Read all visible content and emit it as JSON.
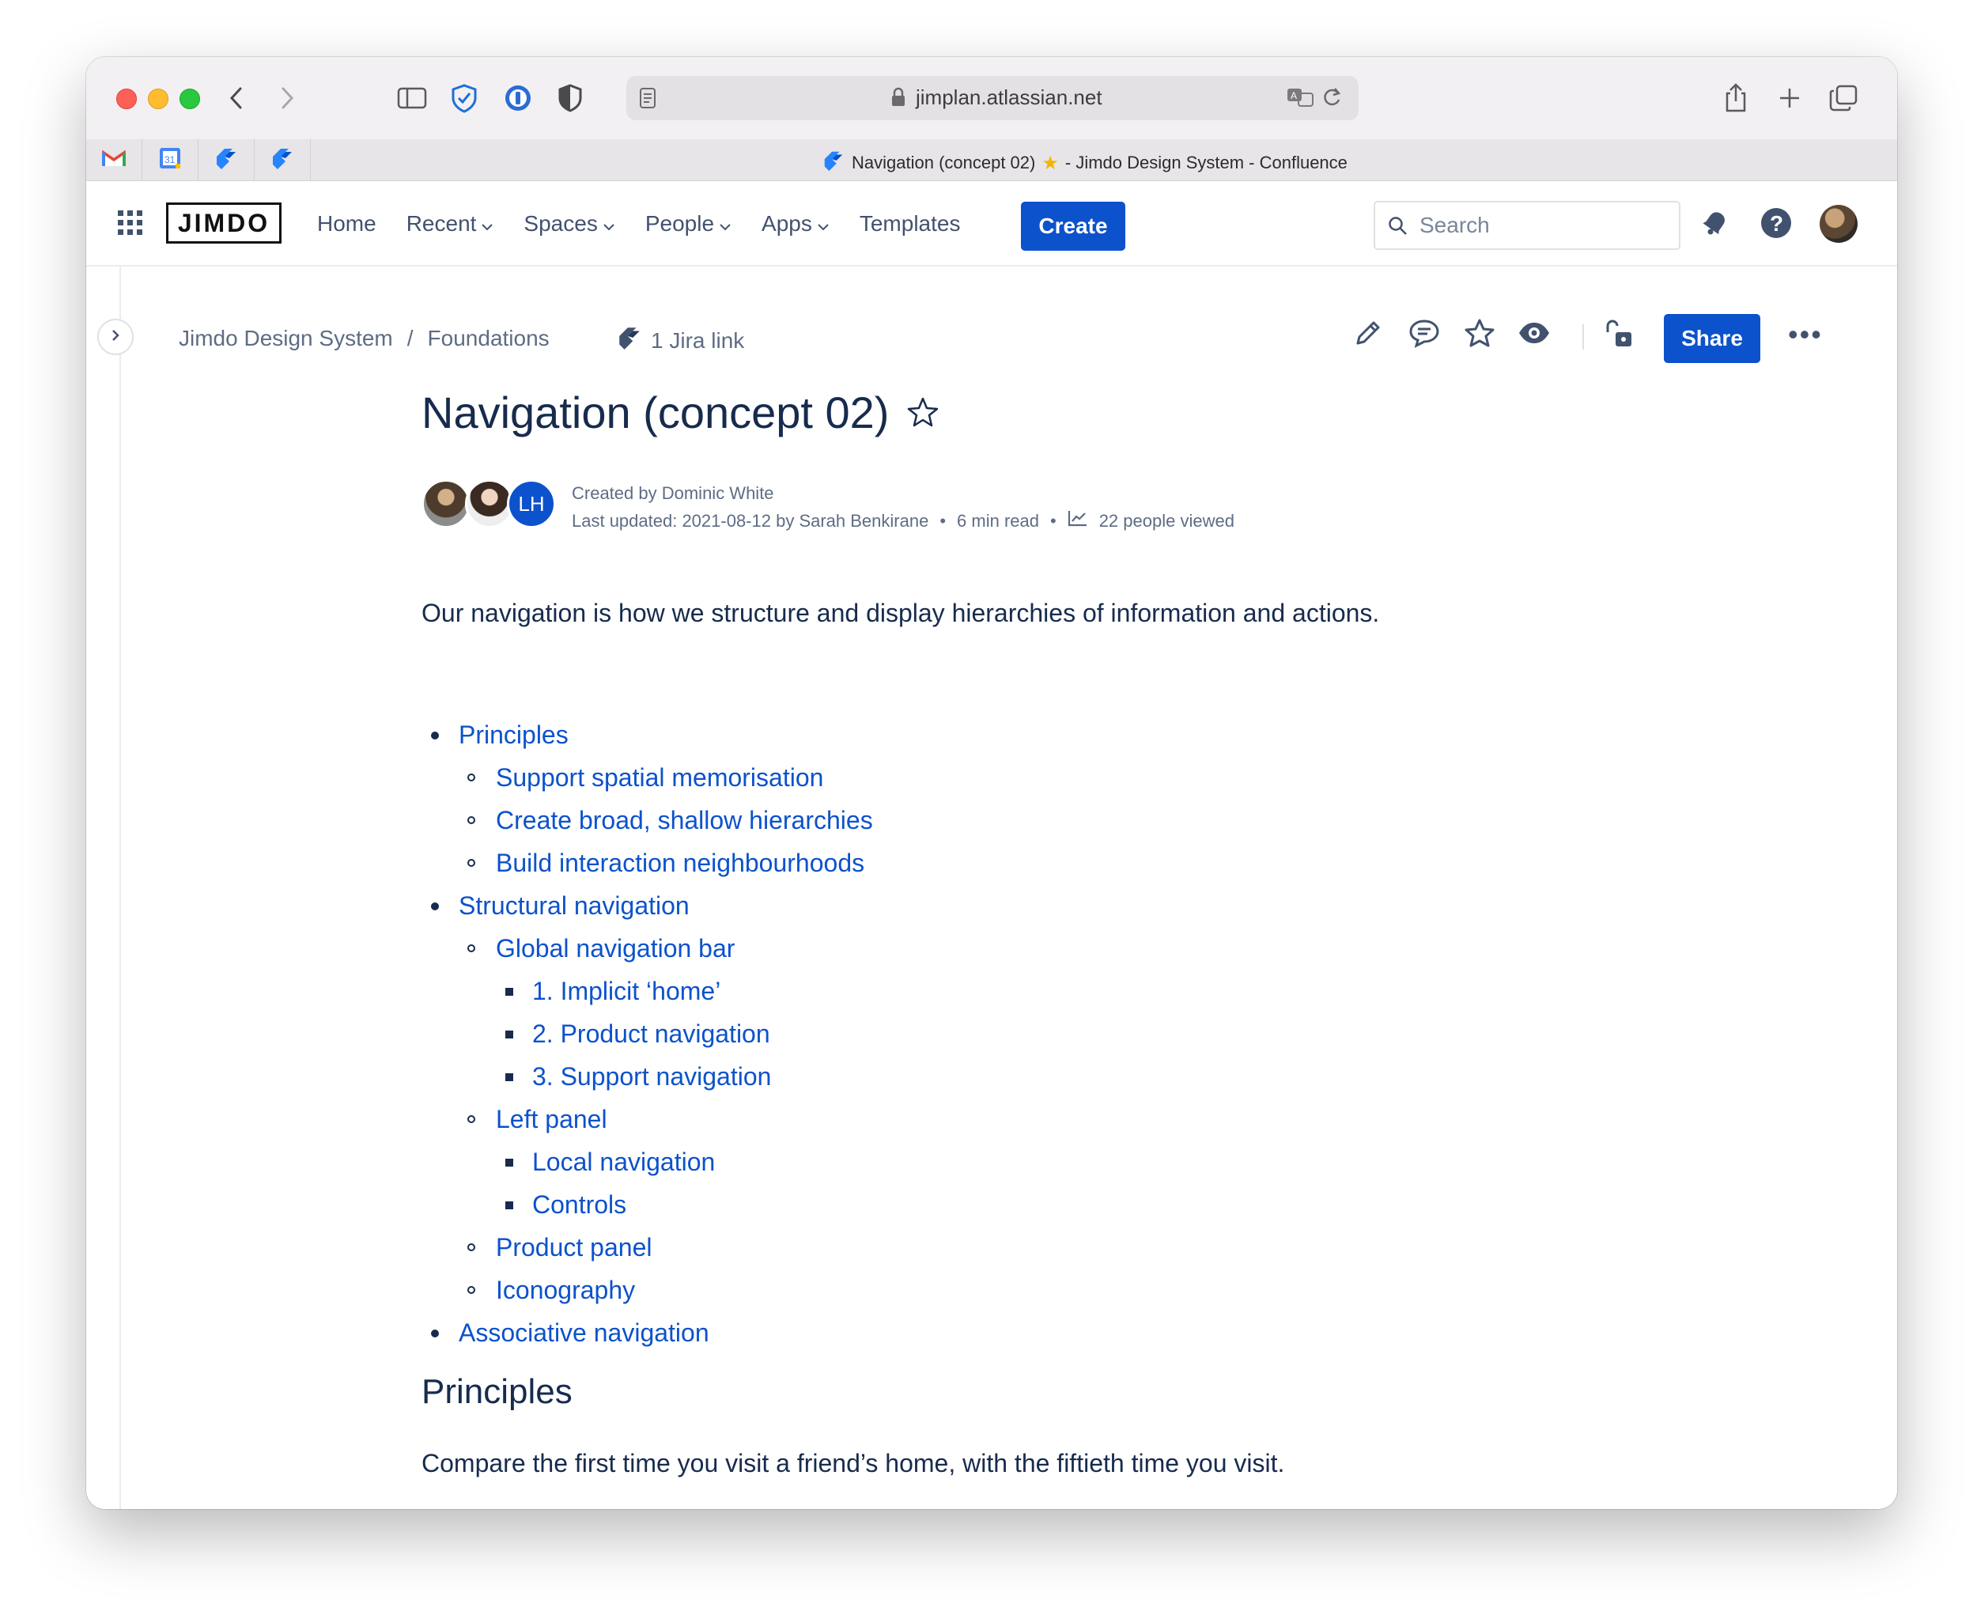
{
  "browser": {
    "url": "jimplan.atlassian.net",
    "tab_title": "Navigation (concept 02)",
    "tab_title_suffix": "- Jimdo Design System - Confluence",
    "pinned_tabs": [
      "gmail-icon",
      "calendar-icon",
      "jira-icon",
      "jira-icon"
    ]
  },
  "header": {
    "logo": "JIMDO",
    "nav": [
      {
        "label": "Home",
        "dropdown": false
      },
      {
        "label": "Recent",
        "dropdown": true
      },
      {
        "label": "Spaces",
        "dropdown": true
      },
      {
        "label": "People",
        "dropdown": true
      },
      {
        "label": "Apps",
        "dropdown": true
      },
      {
        "label": "Templates",
        "dropdown": false
      }
    ],
    "create_label": "Create",
    "search_placeholder": "Search"
  },
  "breadcrumb": {
    "space": "Jimdo Design System",
    "separator": "/",
    "parent": "Foundations"
  },
  "jira_link": "1 Jira link",
  "share_label": "Share",
  "page": {
    "title": "Navigation (concept 02)",
    "avatar_initials": "LH",
    "created_by": "Created by Dominic White",
    "last_updated": "Last updated: 2021-08-12 by Sarah Benkirane",
    "read_time": "6 min read",
    "views": "22 people viewed",
    "intro": "Our navigation is how we structure and display hierarchies of information and actions.",
    "toc": [
      {
        "level": 1,
        "label": "Principles"
      },
      {
        "level": 2,
        "label": "Support spatial memorisation"
      },
      {
        "level": 2,
        "label": "Create broad, shallow hierarchies"
      },
      {
        "level": 2,
        "label": "Build interaction neighbourhoods"
      },
      {
        "level": 1,
        "label": "Structural navigation"
      },
      {
        "level": 2,
        "label": "Global navigation bar"
      },
      {
        "level": 3,
        "label": "1. Implicit ‘home’"
      },
      {
        "level": 3,
        "label": "2. Product navigation"
      },
      {
        "level": 3,
        "label": "3. Support navigation"
      },
      {
        "level": 2,
        "label": "Left panel"
      },
      {
        "level": 3,
        "label": "Local navigation"
      },
      {
        "level": 3,
        "label": "Controls"
      },
      {
        "level": 2,
        "label": "Product panel"
      },
      {
        "level": 2,
        "label": "Iconography"
      },
      {
        "level": 1,
        "label": "Associative navigation"
      }
    ],
    "section_heading": "Principles",
    "section_text": "Compare the first time you visit a friend’s home, with the fiftieth time you visit."
  },
  "colors": {
    "brand_blue": "#0c52cc",
    "text": "#172b4d",
    "muted": "#5e6c84"
  }
}
